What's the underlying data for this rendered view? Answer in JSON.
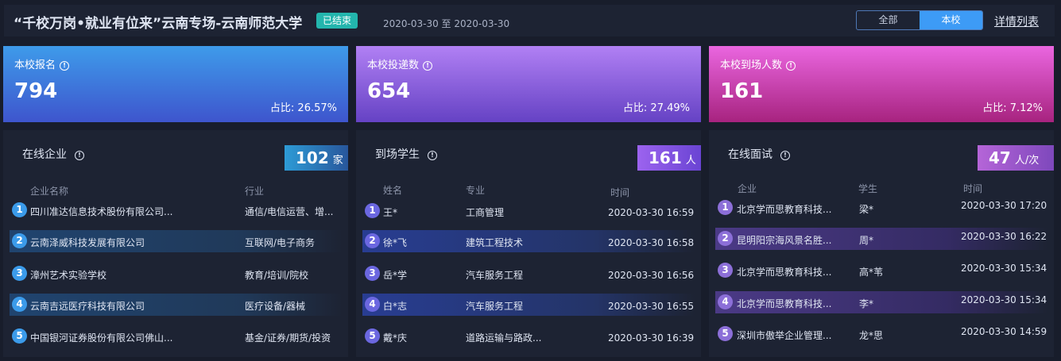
{
  "header": {
    "title": "“千校万岗•就业有位来”云南专场-云南师范大学",
    "badge": "已结束",
    "date_range": "2020-03-30 至 2020-03-30",
    "toggle": [
      "全部",
      "本校"
    ],
    "toggle_selected": "本校",
    "detail_link": "详情列表"
  },
  "stats": [
    {
      "label": "本校报名",
      "value": "794",
      "ratio": "占比:  26.57%"
    },
    {
      "label": "本校投递数",
      "value": "654",
      "ratio": "占比:  27.49%"
    },
    {
      "label": "本校到场人数",
      "value": "161",
      "ratio": "占比:  7.12%"
    }
  ],
  "online_companies": {
    "title": "在线企业",
    "count": "102",
    "unit": "家",
    "columns": [
      "企业名称",
      "行业"
    ],
    "rows": [
      {
        "rank": "1",
        "name": "四川准达信息技术股份有限公司...",
        "industry": "通信/电信运营、增..."
      },
      {
        "rank": "2",
        "name": "云南泽威科技发展有限公司",
        "industry": "互联网/电子商务"
      },
      {
        "rank": "3",
        "name": "漳州艺术实验学校",
        "industry": "教育/培训/院校"
      },
      {
        "rank": "4",
        "name": "云南吉远医疗科技有限公司",
        "industry": "医疗设备/器械"
      },
      {
        "rank": "5",
        "name": "中国银河证券股份有限公司佛山...",
        "industry": "基金/证券/期货/投资"
      }
    ]
  },
  "arrived_students": {
    "title": "到场学生",
    "count": "161",
    "unit": "人",
    "columns": [
      "姓名",
      "专业",
      "时间"
    ],
    "rows": [
      {
        "rank": "1",
        "name": "王*",
        "major": "工商管理",
        "time": "2020-03-30 16:59"
      },
      {
        "rank": "2",
        "name": "徐*飞",
        "major": "建筑工程技术",
        "time": "2020-03-30 16:58"
      },
      {
        "rank": "3",
        "name": "岳*学",
        "major": "汽车服务工程",
        "time": "2020-03-30 16:56"
      },
      {
        "rank": "4",
        "name": "白*志",
        "major": "汽车服务工程",
        "time": "2020-03-30 16:55"
      },
      {
        "rank": "5",
        "name": "戴*庆",
        "major": "道路运输与路政...",
        "time": "2020-03-30 16:39"
      }
    ]
  },
  "online_interviews": {
    "title": "在线面试",
    "count": "47",
    "unit": "人/次",
    "columns": [
      "企业",
      "学生",
      "时间"
    ],
    "rows": [
      {
        "rank": "1",
        "company": "北京学而思教育科技...",
        "student": "梁*",
        "time": "2020-03-30 17:20"
      },
      {
        "rank": "2",
        "company": "昆明阳宗海风景名胜...",
        "student": "周*",
        "time": "2020-03-30 16:22"
      },
      {
        "rank": "3",
        "company": "北京学而思教育科技...",
        "student": "高*苇",
        "time": "2020-03-30 15:34"
      },
      {
        "rank": "4",
        "company": "北京学而思教育科技...",
        "student": "李*",
        "time": "2020-03-30 15:34"
      },
      {
        "rank": "5",
        "company": "深圳市傲举企业管理...",
        "student": "龙*思",
        "time": "2020-03-30 14:59"
      }
    ]
  },
  "colors": {
    "accent": "#3d9bf6",
    "badge": "#23b5ad",
    "background": "#181d2b",
    "panel": "#1d2333"
  }
}
